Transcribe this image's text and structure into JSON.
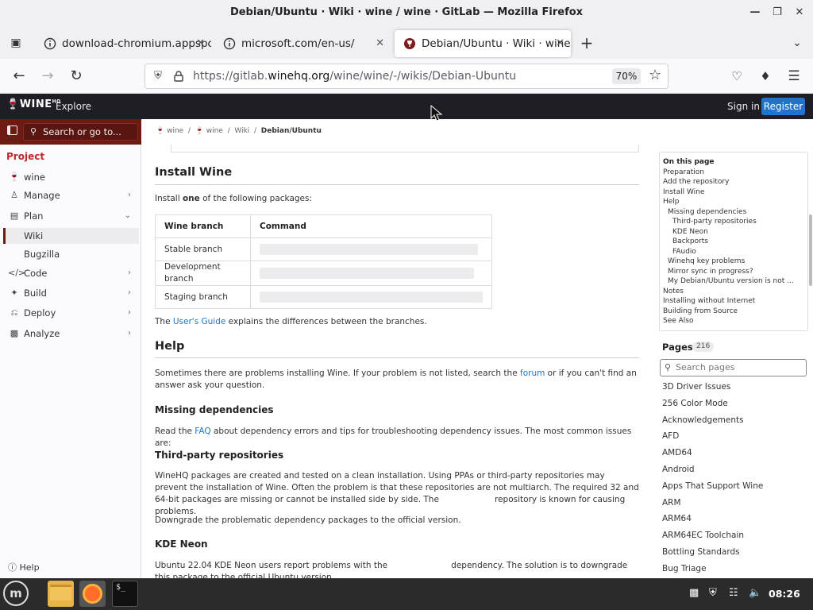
{
  "window": {
    "title": "Debian/Ubuntu · Wiki · wine / wine · GitLab — Mozilla Firefox"
  },
  "tabs": [
    {
      "label": "download-chromium.appspot",
      "active": false
    },
    {
      "label": "microsoft.com/en-us/",
      "active": false
    },
    {
      "label": "Debian/Ubuntu · Wiki · wine",
      "active": true
    }
  ],
  "nav": {
    "url_prefix": "https://gitlab.",
    "url_domain": "winehq.org",
    "url_path": "/wine/wine/-/wikis/Debian-Ubuntu",
    "zoom": "70%"
  },
  "gitlab_header": {
    "logo": "WINE",
    "logo_sup": "HQ",
    "explore": "Explore",
    "sign_in": "Sign in",
    "register": "Register"
  },
  "sidebar": {
    "search_placeholder": "Search or go to...",
    "section": "Project",
    "items": [
      {
        "label": "wine"
      },
      {
        "label": "Manage"
      },
      {
        "label": "Plan"
      },
      {
        "label": "Wiki"
      },
      {
        "label": "Bugzilla"
      },
      {
        "label": "Code"
      },
      {
        "label": "Build"
      },
      {
        "label": "Deploy"
      },
      {
        "label": "Analyze"
      }
    ],
    "help": "Help"
  },
  "breadcrumb": [
    "wine",
    "wine",
    "Wiki",
    "Debian/Ubuntu"
  ],
  "content": {
    "install_title": "Install Wine",
    "install_intro_pre": "Install ",
    "install_intro_bold": "one",
    "install_intro_post": " of the following packages:",
    "table_headers": [
      "Wine branch",
      "Command"
    ],
    "table_rows": [
      "Stable branch",
      "Development branch",
      "Staging branch"
    ],
    "guide_pre": "The ",
    "guide_link": "User's Guide",
    "guide_post": " explains the differences between the branches.",
    "help_title": "Help",
    "help_text_1": "Sometimes there are problems installing Wine. If your problem is not listed, search the ",
    "help_link": "forum",
    "help_text_2": " or if you can't find an answer ask your question.",
    "missing_title": "Missing dependencies",
    "missing_pre": "Read the ",
    "missing_link": "FAQ",
    "missing_post": " about dependency errors and tips for troubleshooting dependency issues. The most common issues are:",
    "third_title": "Third-party repositories",
    "third_text": "WineHQ packages are created and tested on a clean installation. Using PPAs or third-party repositories may prevent the installation of Wine. Often the problem is that these repositories are not multiarch. The required 32 and 64-bit packages are missing or cannot be installed side by side. The                     repository is known for causing problems.",
    "downgrade_text": "Downgrade the problematic dependency packages to the official version.",
    "kde_title": "KDE Neon",
    "kde_text": "Ubuntu 22.04 KDE Neon users report problems with the                        dependency. The solution is to downgrade this package to the official Ubuntu version."
  },
  "toc": {
    "title": "On this page",
    "items": [
      {
        "label": "Preparation",
        "level": 0
      },
      {
        "label": "Add the repository",
        "level": 0
      },
      {
        "label": "Install Wine",
        "level": 0
      },
      {
        "label": "Help",
        "level": 0
      },
      {
        "label": "Missing dependencies",
        "level": 1
      },
      {
        "label": "Third-party repositories",
        "level": 2
      },
      {
        "label": "KDE Neon",
        "level": 2
      },
      {
        "label": "Backports",
        "level": 2
      },
      {
        "label": "FAudio",
        "level": 2
      },
      {
        "label": "Winehq key problems",
        "level": 1
      },
      {
        "label": "Mirror sync in progress?",
        "level": 1
      },
      {
        "label": "My Debian/Ubuntu version is not ...",
        "level": 1
      },
      {
        "label": "Notes",
        "level": 0
      },
      {
        "label": "Installing without Internet",
        "level": 0
      },
      {
        "label": "Building from Source",
        "level": 0
      },
      {
        "label": "See Also",
        "level": 0
      }
    ]
  },
  "pages": {
    "title": "Pages",
    "count": "216",
    "search_placeholder": "Search pages",
    "items": [
      "3D Driver Issues",
      "256 Color Mode",
      "Acknowledgements",
      "AFD",
      "AMD64",
      "Android",
      "Apps That Support Wine",
      "ARM",
      "ARM64",
      "ARM64EC Toolchain",
      "Bottling Standards",
      "Bug Triage"
    ]
  },
  "taskbar": {
    "clock": "08:26"
  },
  "colors": {
    "gitlab_header": "#1f1e24",
    "sidebar_top": "#6d1a12",
    "link": "#1f75cb",
    "register_button": "#1f75cb"
  }
}
